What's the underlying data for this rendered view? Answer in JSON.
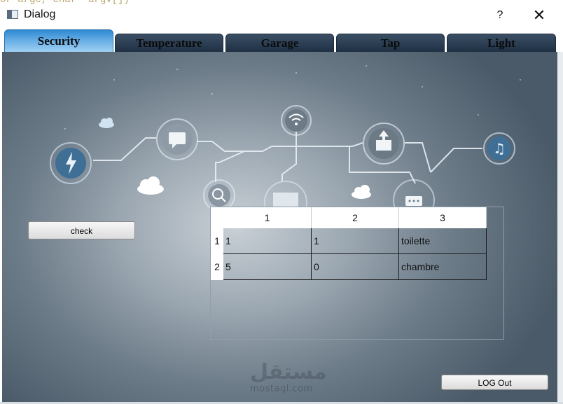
{
  "window": {
    "background_code_text": "or argc, char *argv[])",
    "title": "Dialog",
    "help_label": "?",
    "close_label": "✕"
  },
  "tabs": [
    {
      "label": "Security",
      "active": true
    },
    {
      "label": "Temperature",
      "active": false
    },
    {
      "label": "Garage",
      "active": false
    },
    {
      "label": "Tap",
      "active": false
    },
    {
      "label": "Light",
      "active": false
    }
  ],
  "buttons": {
    "check_label": "check",
    "logout_label": "LOG Out"
  },
  "table": {
    "columns": [
      "1",
      "2",
      "3"
    ],
    "row_headers": [
      "1",
      "2"
    ],
    "rows": [
      [
        "1",
        "1",
        "toilette"
      ],
      [
        "5",
        "0",
        "chambre"
      ]
    ]
  },
  "background_icons": [
    "lightning-icon",
    "chat-icon",
    "wifi-icon",
    "mail-upload-icon",
    "music-note-icon",
    "search-icon",
    "monitor-icon",
    "message-dots-icon",
    "cloud-icon"
  ],
  "watermark": {
    "arabic": "مستقل",
    "text": "mostaql.com"
  },
  "colors": {
    "active_tab": "#4a9fe0",
    "inactive_tab": "#2c3e52",
    "content_bg": "#6d7c89"
  }
}
